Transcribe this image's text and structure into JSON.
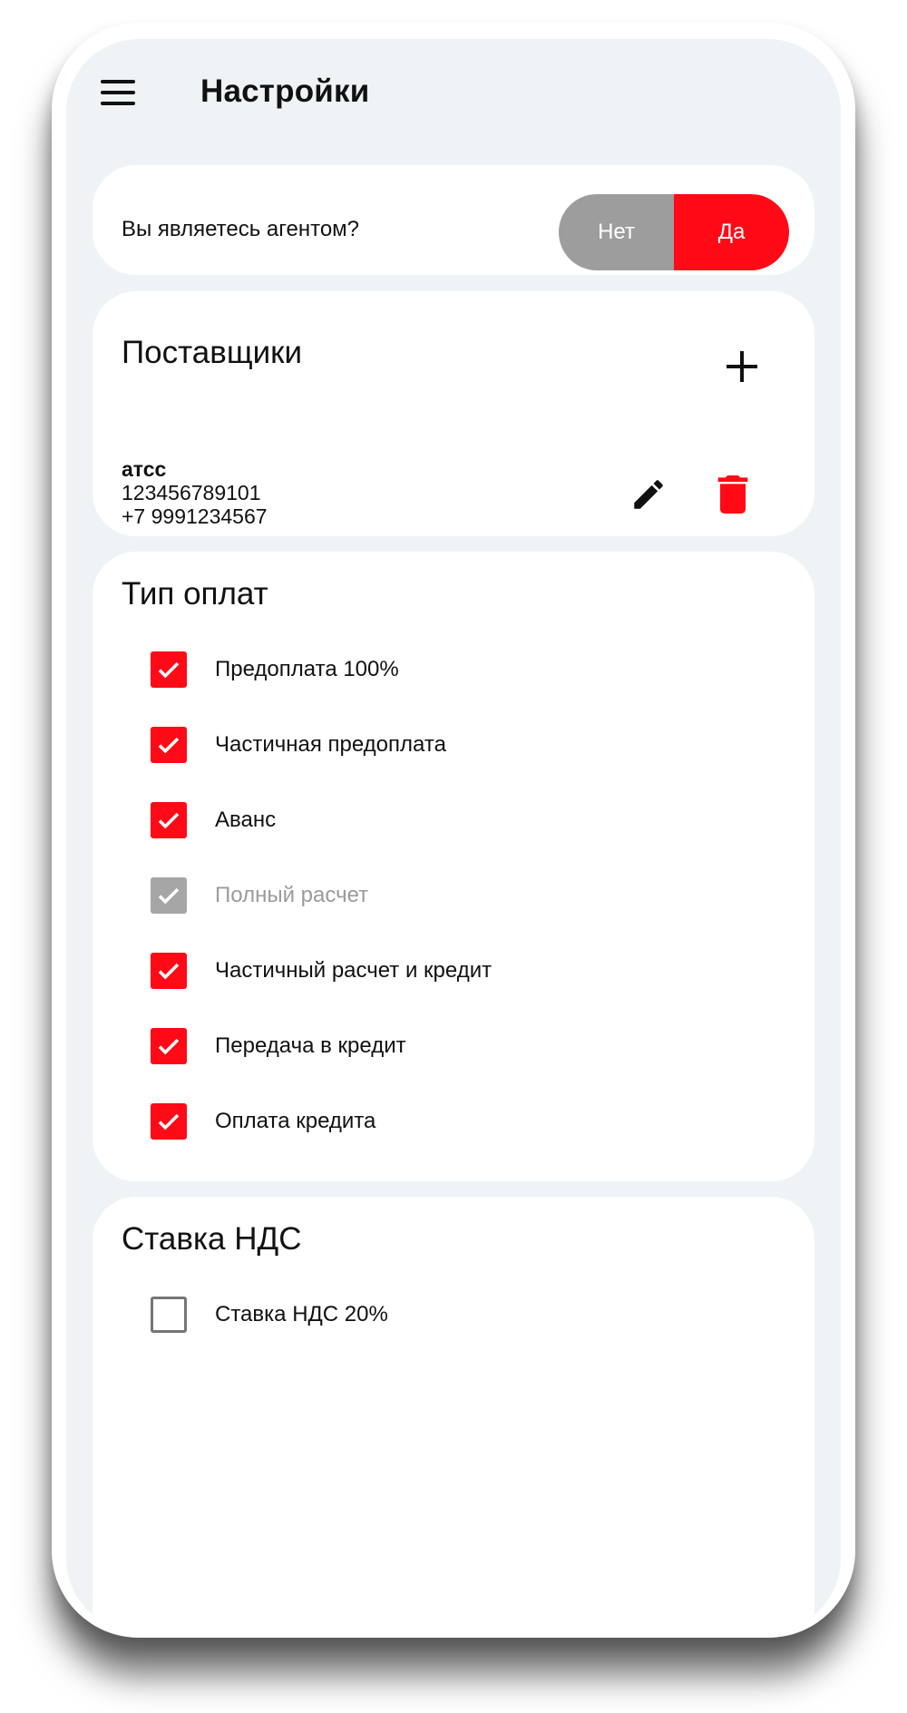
{
  "header": {
    "title": "Настройки"
  },
  "agent": {
    "question": "Вы являетесь агентом?",
    "options": [
      "Нет",
      "Да"
    ],
    "selected": "Да"
  },
  "suppliers": {
    "title": "Поставщики",
    "items": [
      {
        "name": "атсс",
        "inn": "123456789101",
        "phone": "+7 9991234567"
      }
    ]
  },
  "payment_types": {
    "title": "Тип оплат",
    "items": [
      {
        "label": "Предоплата 100%",
        "checked": true,
        "disabled": false
      },
      {
        "label": "Частичная предоплата",
        "checked": true,
        "disabled": false
      },
      {
        "label": "Аванс",
        "checked": true,
        "disabled": false
      },
      {
        "label": "Полный расчет",
        "checked": true,
        "disabled": true
      },
      {
        "label": "Частичный расчет и кредит",
        "checked": true,
        "disabled": false
      },
      {
        "label": "Передача в кредит",
        "checked": true,
        "disabled": false
      },
      {
        "label": "Оплата кредита",
        "checked": true,
        "disabled": false
      }
    ]
  },
  "vat": {
    "title": "Ставка НДС",
    "items": [
      {
        "label": "Ставка НДС 20%",
        "checked": false,
        "disabled": false
      }
    ]
  },
  "colors": {
    "accent": "#ff0a16",
    "toggle_off": "#9d9d9d",
    "disabled": "#a6a6a6",
    "background": "#f0f3f6"
  }
}
